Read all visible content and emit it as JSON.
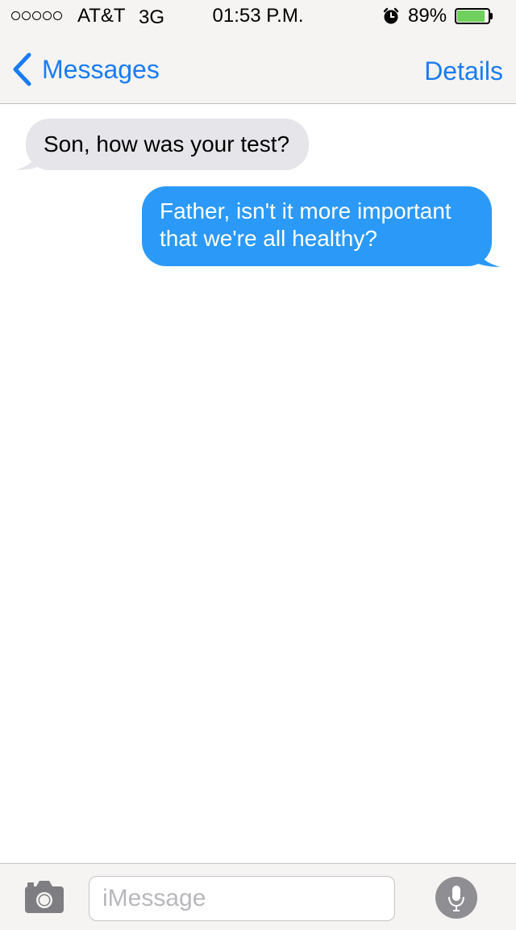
{
  "status_bar": {
    "carrier": "AT&T",
    "network": "3G",
    "time": "01:53 P.M.",
    "alarm_icon": "alarm-clock-icon",
    "battery_percent_label": "89%",
    "battery_level": 0.89,
    "battery_color": "#6fd05e",
    "signal_bars_filled": 0,
    "signal_bars_total": 5
  },
  "nav": {
    "back_icon": "chevron-left-icon",
    "back_label": "Messages",
    "details_label": "Details",
    "accent_color": "#1b7cf2"
  },
  "messages": [
    {
      "direction": "incoming",
      "text": "Son, how was your test?",
      "color": "#e5e5ea"
    },
    {
      "direction": "outgoing",
      "text": "Father, isn't it more important that we're all healthy?",
      "color": "#2b99f7"
    }
  ],
  "composer": {
    "camera_icon": "camera-icon",
    "placeholder": "iMessage",
    "value": "",
    "mic_icon": "microphone-icon"
  }
}
